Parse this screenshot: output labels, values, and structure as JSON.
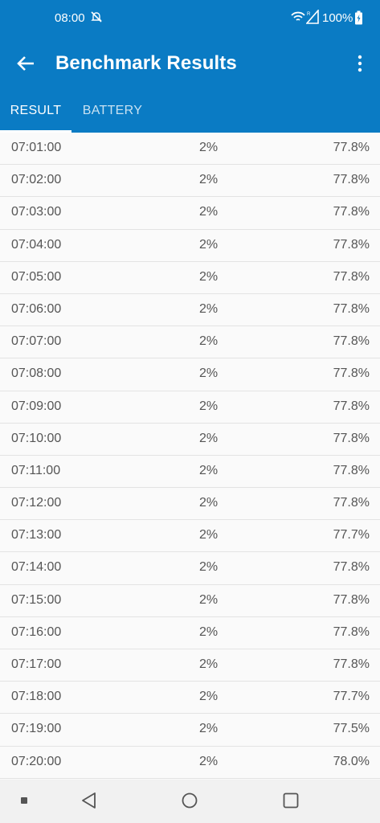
{
  "status_bar": {
    "time": "08:00",
    "battery_percent": "100%"
  },
  "app_bar": {
    "title": "Benchmark Results"
  },
  "tabs": [
    {
      "label": "RESULT",
      "active": true
    },
    {
      "label": "BATTERY",
      "active": false
    }
  ],
  "rows": [
    {
      "time": "07:01:00",
      "value": "2%",
      "percent": "77.8%"
    },
    {
      "time": "07:02:00",
      "value": "2%",
      "percent": "77.8%"
    },
    {
      "time": "07:03:00",
      "value": "2%",
      "percent": "77.8%"
    },
    {
      "time": "07:04:00",
      "value": "2%",
      "percent": "77.8%"
    },
    {
      "time": "07:05:00",
      "value": "2%",
      "percent": "77.8%"
    },
    {
      "time": "07:06:00",
      "value": "2%",
      "percent": "77.8%"
    },
    {
      "time": "07:07:00",
      "value": "2%",
      "percent": "77.8%"
    },
    {
      "time": "07:08:00",
      "value": "2%",
      "percent": "77.8%"
    },
    {
      "time": "07:09:00",
      "value": "2%",
      "percent": "77.8%"
    },
    {
      "time": "07:10:00",
      "value": "2%",
      "percent": "77.8%"
    },
    {
      "time": "07:11:00",
      "value": "2%",
      "percent": "77.8%"
    },
    {
      "time": "07:12:00",
      "value": "2%",
      "percent": "77.8%"
    },
    {
      "time": "07:13:00",
      "value": "2%",
      "percent": "77.7%"
    },
    {
      "time": "07:14:00",
      "value": "2%",
      "percent": "77.8%"
    },
    {
      "time": "07:15:00",
      "value": "2%",
      "percent": "77.8%"
    },
    {
      "time": "07:16:00",
      "value": "2%",
      "percent": "77.8%"
    },
    {
      "time": "07:17:00",
      "value": "2%",
      "percent": "77.8%"
    },
    {
      "time": "07:18:00",
      "value": "2%",
      "percent": "77.7%"
    },
    {
      "time": "07:19:00",
      "value": "2%",
      "percent": "77.5%"
    },
    {
      "time": "07:20:00",
      "value": "2%",
      "percent": "78.0%"
    }
  ],
  "colors": {
    "primary": "#0a7bc4",
    "background": "#fafafa",
    "row_text": "#555555",
    "divider": "#e3e3e3"
  },
  "icons": {
    "dnd": "do-not-disturb-icon",
    "wifi": "wifi-icon",
    "signal": "signal-icon",
    "battery": "battery-icon",
    "back": "arrow-back-icon",
    "overflow": "more-vert-icon"
  }
}
